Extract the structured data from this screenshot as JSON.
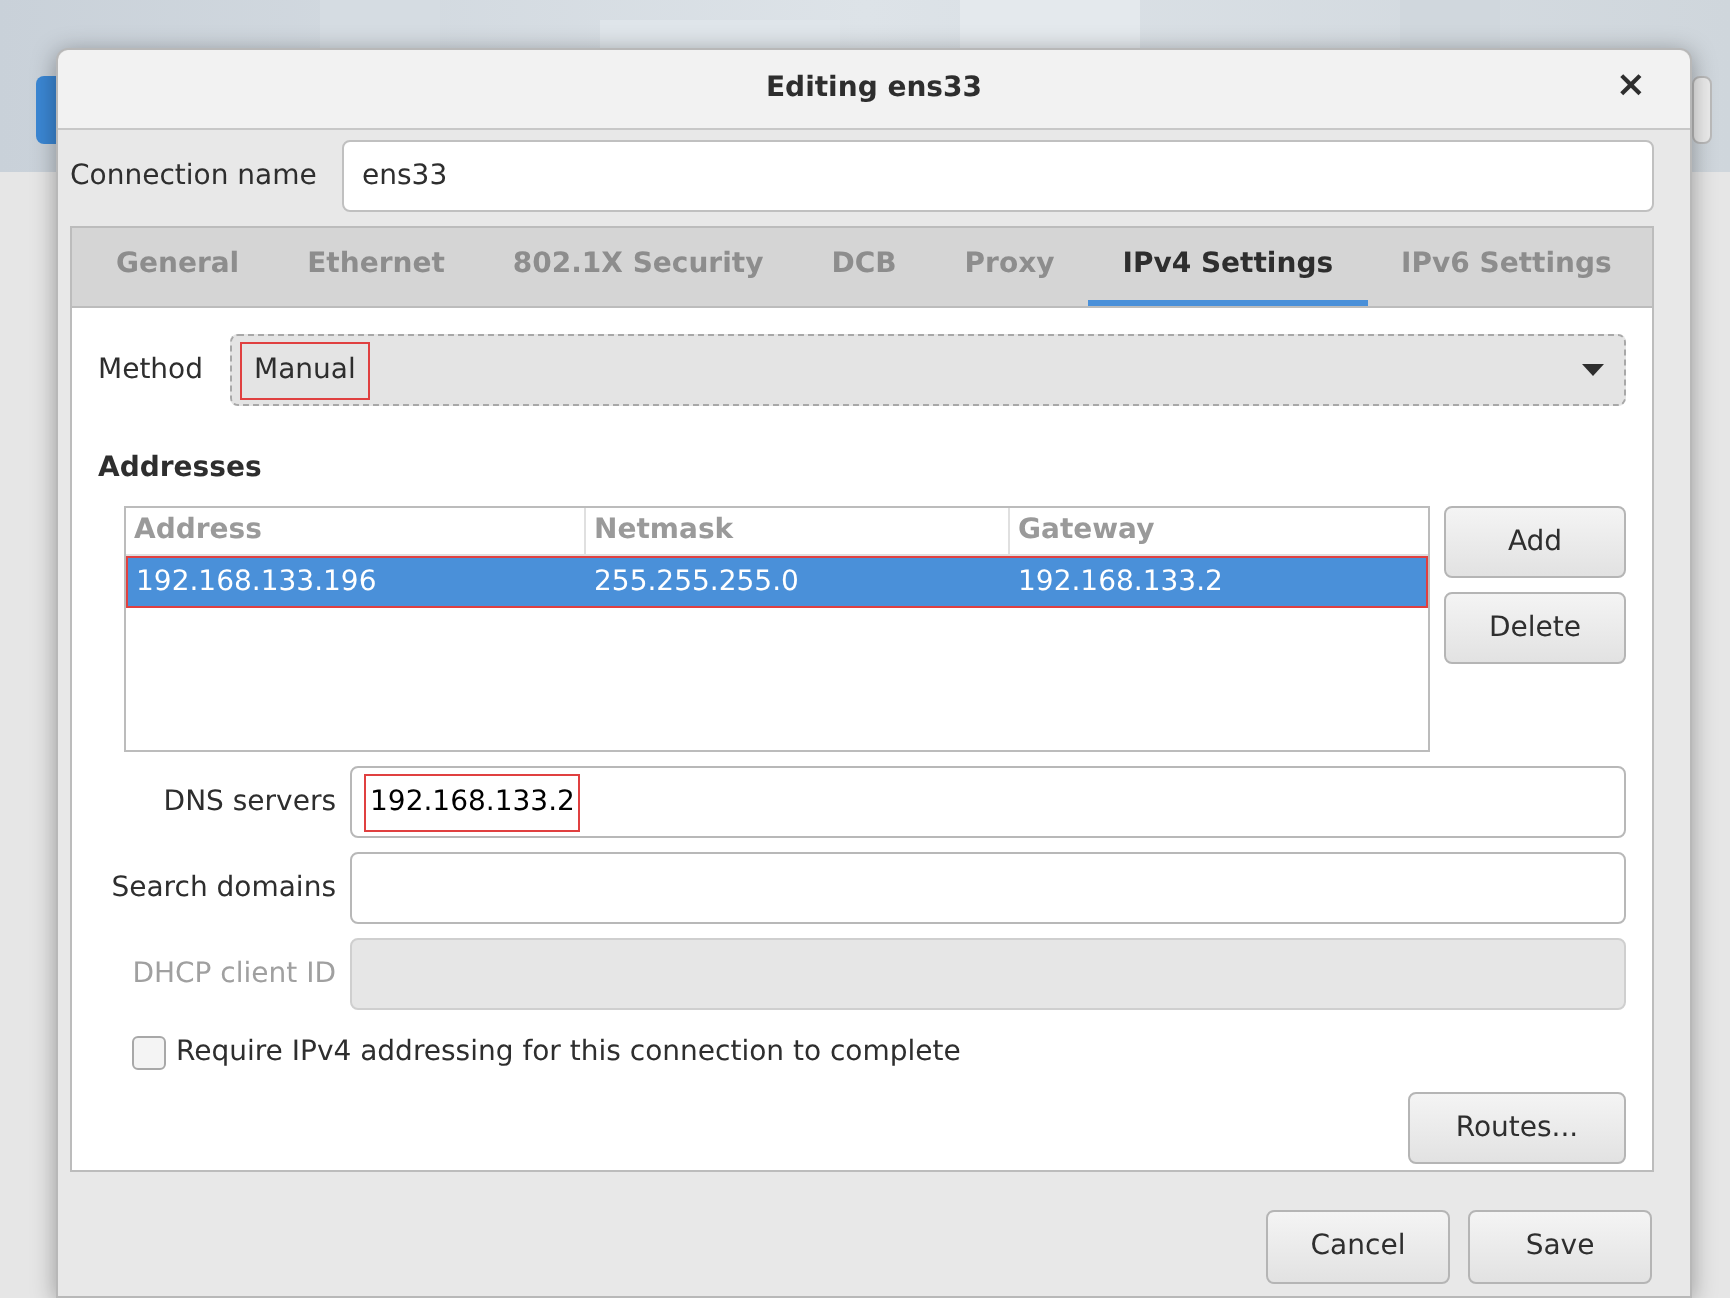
{
  "dialog": {
    "title": "Editing ens33",
    "close": "×"
  },
  "connection_name": {
    "label": "Connection name",
    "value": "ens33"
  },
  "tabs": [
    {
      "label": "General",
      "selected": false
    },
    {
      "label": "Ethernet",
      "selected": false
    },
    {
      "label": "802.1X Security",
      "selected": false
    },
    {
      "label": "DCB",
      "selected": false
    },
    {
      "label": "Proxy",
      "selected": false
    },
    {
      "label": "IPv4 Settings",
      "selected": true
    },
    {
      "label": "IPv6 Settings",
      "selected": false
    }
  ],
  "method": {
    "label": "Method",
    "value": "Manual",
    "highlighted": true
  },
  "addresses": {
    "title": "Addresses",
    "columns": [
      "Address",
      "Netmask",
      "Gateway"
    ],
    "rows": [
      {
        "cells": [
          "192.168.133.196",
          "255.255.255.0",
          "192.168.133.2"
        ],
        "selected": true,
        "highlighted": true
      }
    ],
    "buttons": [
      "Add",
      "Delete"
    ]
  },
  "fields": [
    {
      "label": "DNS servers",
      "value": "192.168.133.2",
      "disabled": false,
      "highlighted": true
    },
    {
      "label": "Search domains",
      "disabled": false
    },
    {
      "label": "DHCP client ID",
      "disabled": true
    }
  ],
  "require_checkbox": {
    "label": "Require IPv4 addressing for this connection to complete",
    "checked": false
  },
  "routes_button": "Routes...",
  "footer_buttons": [
    "Cancel",
    "Save"
  ]
}
